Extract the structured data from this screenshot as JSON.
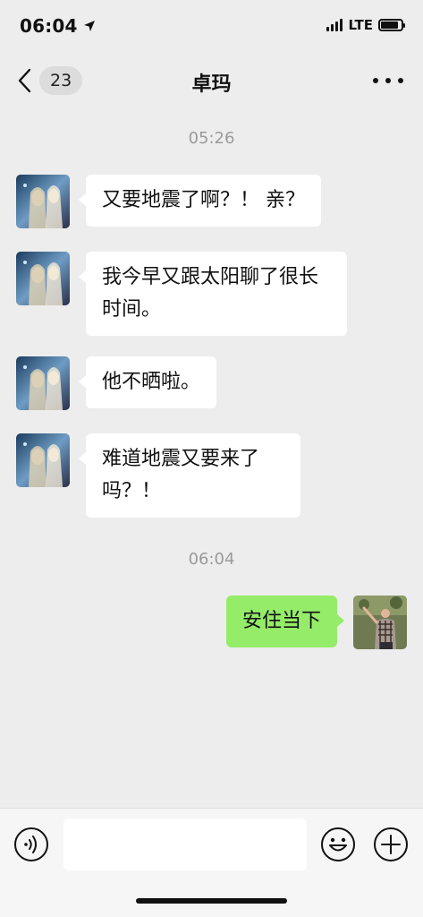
{
  "status_bar": {
    "time": "06:04",
    "network": "LTE",
    "battery_level": 0.85
  },
  "nav": {
    "unread_count": "23",
    "title": "卓玛"
  },
  "timestamps": [
    "05:26",
    "06:04"
  ],
  "messages": [
    {
      "sender": "contact",
      "text": "又要地震了啊？！ 亲？"
    },
    {
      "sender": "contact",
      "text": "我今早又跟太阳聊了很长时间。"
    },
    {
      "sender": "contact",
      "text": "他不晒啦。"
    },
    {
      "sender": "contact",
      "text": "难道地震又要来了吗？！"
    },
    {
      "sender": "me",
      "text": "安住当下"
    }
  ],
  "input": {
    "placeholder": ""
  },
  "colors": {
    "background": "#ededed",
    "sent_bubble": "#95ec69",
    "received_bubble": "#ffffff",
    "timestamp_text": "#9a9a9a"
  }
}
